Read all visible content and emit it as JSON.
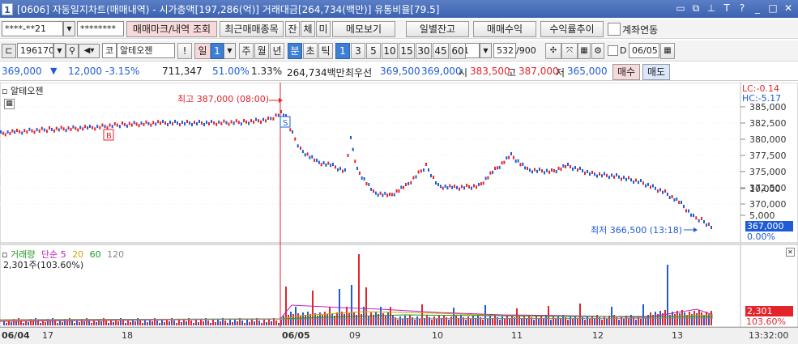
{
  "window": {
    "screen_no": "1",
    "title": "[0606] 자동일지차트(매매내역) - 시가총액[197,286(억)] 거래대금[264,734(백만)] 유통비율[79.5]",
    "buttons": [
      "□",
      "⧉",
      "푸",
      "T",
      "?",
      "_",
      "□",
      "✕"
    ]
  },
  "toolbar1": {
    "account": "****-**21",
    "password": "********",
    "trade_mark_btn": "매매마크/내역 조회",
    "recent_btn": "최근매매종목",
    "tab_jan": "잔",
    "tab_che": "체",
    "tab_mi": "미",
    "memo_btn": "메모보기",
    "daily_btn": "일별잔고",
    "profit_btn": "매매수익",
    "rate_btn": "수익률추이",
    "link_label": "계좌연동"
  },
  "toolbar2": {
    "code": "196170",
    "market": "코",
    "stock_name": "알테오젠",
    "period_day": "일",
    "period_n": "1",
    "week": "주",
    "month": "월",
    "year": "년",
    "minute": "분",
    "second": "초",
    "tick": "틱",
    "intervals": [
      "1",
      "3",
      "5",
      "10",
      "15",
      "30",
      "45",
      "60"
    ],
    "interval_active": "1",
    "multiplier": "1",
    "count": "532",
    "count_max": "/900",
    "d_label": "D",
    "date": "06/05"
  },
  "quote": {
    "price": "369,000",
    "change_sign": "▼",
    "change": "12,000",
    "change_rate": "-3.15%",
    "volume": "711,347",
    "vol_rate": "51.00%",
    "turnover": "1.33%",
    "amount": "264,734백만",
    "ask_label": "최우선",
    "ask": "369,500",
    "bid": "369,000",
    "open_label": "시",
    "open": "383,500",
    "high_label": "고",
    "high": "387,000",
    "low_label": "저",
    "low": "365,000",
    "buy_btn": "매수",
    "sell_btn": "매도"
  },
  "price_panel": {
    "stock_label": "알테오젠",
    "lc": "LC:-0.14",
    "hc": "HC:-5.17",
    "high_note": "최고 387,000 (08:00)",
    "low_note": "최저 366,500 (13:18)",
    "axis_labels": [
      "385,000",
      "382,500",
      "380,000",
      "377,500",
      "375,000",
      "372,500",
      "370,000"
    ],
    "current_tag": "367,000",
    "current_pct": "0.00%",
    "buy_marker": "B",
    "sell_marker": "S",
    "colors": {
      "up": "#e3242b",
      "down": "#1f5bd6",
      "vline": "#e3242b"
    }
  },
  "volume_panel": {
    "title": "거래량",
    "ma_label": "단순",
    "ma_periods": [
      "5",
      "20",
      "60",
      "120"
    ],
    "ma_colors": [
      "#c01fc0",
      "#c8a600",
      "#1e9a1e",
      "#888888"
    ],
    "value_label": "2,301주(103.60%)",
    "axis_labels": [
      "10,000",
      "5,000"
    ],
    "current_tag": "2,301",
    "current_pct": "103.60%"
  },
  "date_axis": {
    "labels": [
      "06/04",
      "17",
      "18",
      "06/05",
      "09",
      "10",
      "11",
      "12",
      "13"
    ],
    "time": "13:32:00"
  }
}
